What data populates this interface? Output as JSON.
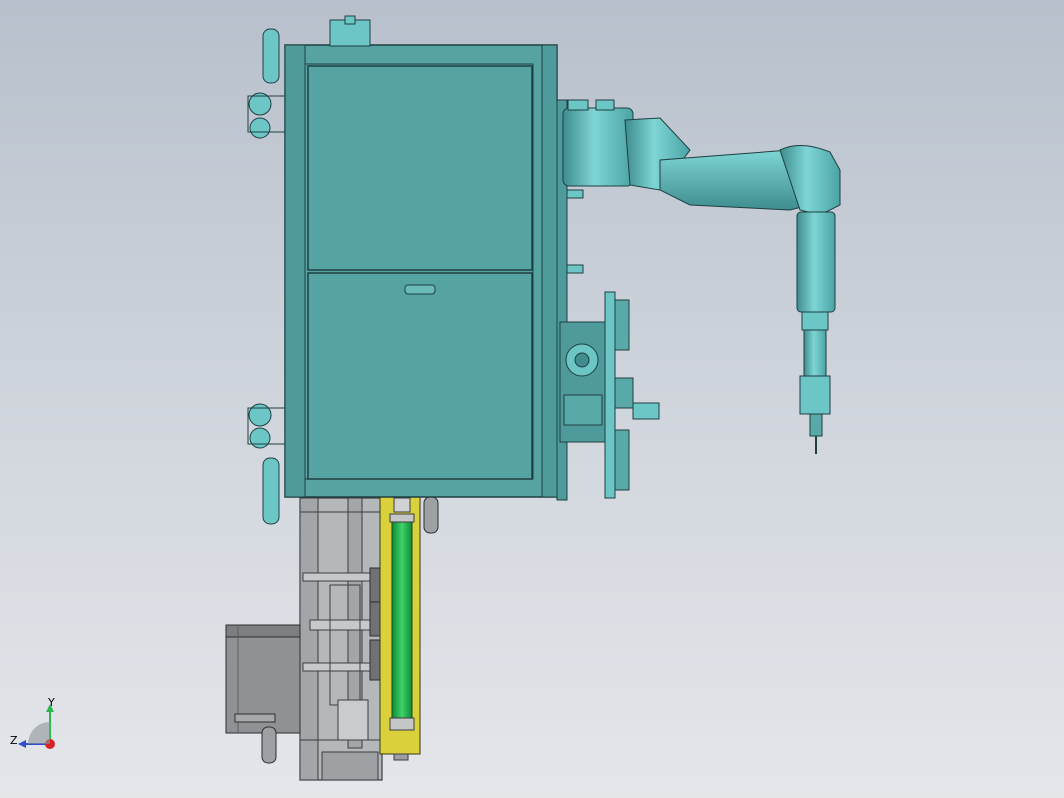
{
  "viewport": {
    "background_top": "#b7c0cc",
    "background_bottom": "#e4e6ea"
  },
  "model": {
    "colors": {
      "body": "#55a3a3",
      "body_edge": "#1f3f40",
      "robot": "#6cc6c6",
      "robot_dark": "#3f8d8e",
      "frame_gray": "#9a9d9f",
      "motor_gray": "#8f9294",
      "yellow": "#d9d03b",
      "green": "#22b14c"
    }
  },
  "triad": {
    "y_label": "Y",
    "z_label": "Z",
    "y_color": "#2db84d",
    "z_color": "#2f4fd0",
    "x_color": "#d42424"
  }
}
